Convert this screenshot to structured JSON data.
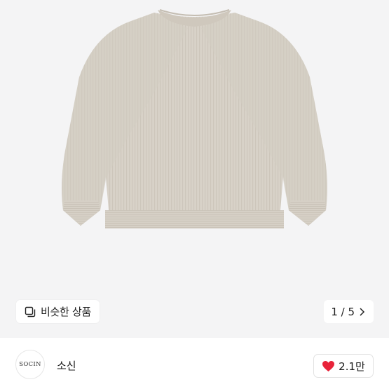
{
  "gallery": {
    "similar_products_label": "비슷한 상품",
    "page_indicator": "1 / 5",
    "image_icon": "sweater-product-photo"
  },
  "seller": {
    "logo_text": "SOCIN",
    "name": "소신"
  },
  "like": {
    "count": "2.1만",
    "icon": "heart-icon",
    "color": "#e8233a"
  },
  "colors": {
    "hero_bg": "#f4f4f5",
    "sweater": "#d9d3ca"
  }
}
